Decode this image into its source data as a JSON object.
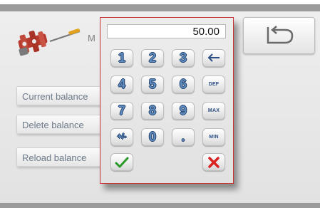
{
  "header": {
    "title_fragment": "M"
  },
  "side_menu": {
    "items": [
      {
        "label": "Current balance"
      },
      {
        "label": "Delete balance"
      },
      {
        "label": "Reload balance"
      }
    ]
  },
  "keypad": {
    "display_value": "50.00",
    "keys": {
      "k1": "1",
      "k2": "2",
      "k3": "3",
      "k4": "4",
      "k5": "5",
      "k6": "6",
      "k7": "7",
      "k8": "8",
      "k9": "9",
      "k0": "0",
      "dot": ".",
      "sign": "+/-",
      "def": "DEF",
      "max": "MAX",
      "min": "MIN"
    },
    "icons": {
      "backspace": "backspace-arrow-icon",
      "ok": "checkmark-icon",
      "cancel": "cross-icon",
      "back": "undo-arrow-icon",
      "app": "tools-icon"
    }
  },
  "colors": {
    "frame_gray": "#9b9b9b",
    "keypad_border": "#c63434",
    "key_text": "#2d4f86",
    "ok_green": "#2a9a2a",
    "cancel_red": "#d92222"
  }
}
